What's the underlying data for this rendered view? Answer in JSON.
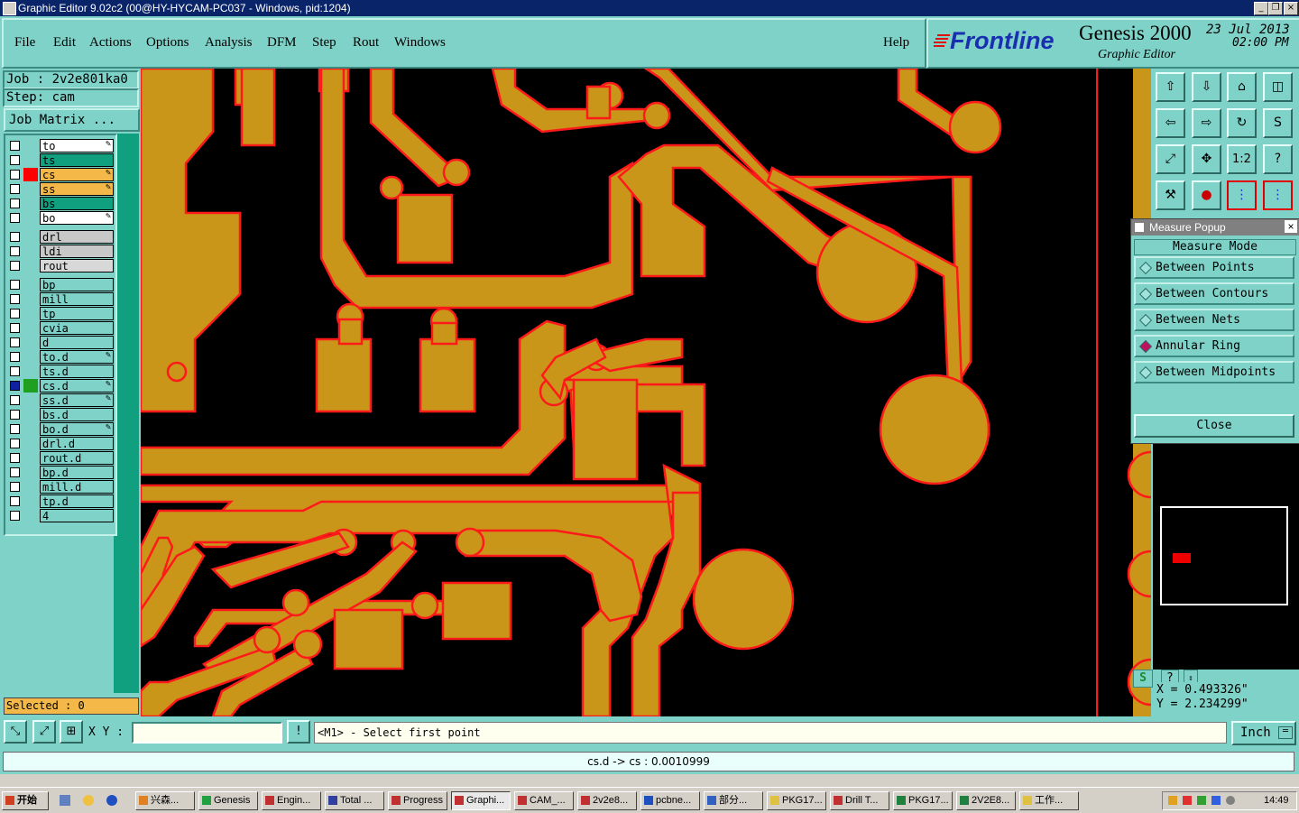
{
  "window": {
    "title": "Graphic Editor 9.02c2 (00@HY-HYCAM-PC037 - Windows, pid:1204)"
  },
  "menu": [
    "File",
    "Edit",
    "Actions",
    "Options",
    "Analysis",
    "DFM",
    "Step",
    "Rout",
    "Windows"
  ],
  "help_label": "Help",
  "brand": {
    "logo": "Frontline",
    "product": "Genesis 2000",
    "subtitle": "Graphic Editor",
    "date": "23 Jul 2013",
    "time": "02:00 PM"
  },
  "job": {
    "job": "Job : 2v2e801ka0",
    "step": "Step: cam",
    "matrix_button": "Job Matrix ..."
  },
  "layers": [
    {
      "name": "to",
      "bg": "#ffffff",
      "swatch": "",
      "edit": true
    },
    {
      "name": "ts",
      "bg": "#10a080",
      "swatch": "",
      "edit": false
    },
    {
      "name": "cs",
      "bg": "#f4b848",
      "swatch": "#ff0000",
      "edit": true
    },
    {
      "name": "ss",
      "bg": "#f4b848",
      "swatch": "",
      "edit": true
    },
    {
      "name": "bs",
      "bg": "#10a080",
      "swatch": "",
      "edit": false
    },
    {
      "name": "bo",
      "bg": "#ffffff",
      "swatch": "",
      "edit": true
    },
    {
      "name": "drl",
      "bg": "#c8c8c8",
      "swatch": "",
      "edit": false
    },
    {
      "name": "ldi",
      "bg": "#c8c8c8",
      "swatch": "",
      "edit": false
    },
    {
      "name": "rout",
      "bg": "#d8d8d8",
      "swatch": "",
      "edit": false
    },
    {
      "name": "bp",
      "bg": "#7fd2c8",
      "swatch": "",
      "edit": false
    },
    {
      "name": "mill",
      "bg": "#7fd2c8",
      "swatch": "",
      "edit": false
    },
    {
      "name": "tp",
      "bg": "#7fd2c8",
      "swatch": "",
      "edit": false
    },
    {
      "name": "cvia",
      "bg": "#7fd2c8",
      "swatch": "",
      "edit": false
    },
    {
      "name": "d",
      "bg": "#7fd2c8",
      "swatch": "",
      "edit": false
    },
    {
      "name": "to.d",
      "bg": "#7fd2c8",
      "swatch": "",
      "edit": true
    },
    {
      "name": "ts.d",
      "bg": "#7fd2c8",
      "swatch": "",
      "edit": false
    },
    {
      "name": "cs.d",
      "bg": "#7fd2c8",
      "swatch": "#20a020",
      "edit": true
    },
    {
      "name": "ss.d",
      "bg": "#7fd2c8",
      "swatch": "",
      "edit": true
    },
    {
      "name": "bs.d",
      "bg": "#7fd2c8",
      "swatch": "",
      "edit": false
    },
    {
      "name": "bo.d",
      "bg": "#7fd2c8",
      "swatch": "",
      "edit": true
    },
    {
      "name": "drl.d",
      "bg": "#7fd2c8",
      "swatch": "",
      "edit": false
    },
    {
      "name": "rout.d",
      "bg": "#7fd2c8",
      "swatch": "",
      "edit": false
    },
    {
      "name": "bp.d",
      "bg": "#7fd2c8",
      "swatch": "",
      "edit": false
    },
    {
      "name": "mill.d",
      "bg": "#7fd2c8",
      "swatch": "",
      "edit": false
    },
    {
      "name": "tp.d",
      "bg": "#7fd2c8",
      "swatch": "",
      "edit": false
    },
    {
      "name": "4",
      "bg": "#7fd2c8",
      "swatch": "",
      "edit": false
    }
  ],
  "selected": "Selected : 0",
  "measure": {
    "title": "Measure Popup",
    "mode_label": "Measure Mode",
    "options": [
      "Between Points",
      "Between Contours",
      "Between Nets",
      "Annular Ring",
      "Between Midpoints"
    ],
    "active_option": "Annular Ring",
    "close_label": "Close"
  },
  "tools": [
    "1:2",
    "?"
  ],
  "coords": {
    "x": "X = 0.493326\"",
    "y": "Y = 2.234299\""
  },
  "cmd": {
    "xy_label": "X Y :",
    "xy_value": "",
    "prompt": "<M1> - Select first point",
    "units": "Inch"
  },
  "message": "cs.d -> cs : 0.0010999",
  "taskbar": {
    "start": "开始",
    "tasks": [
      "兴森...",
      "Genesis",
      "Engin...",
      "Total ...",
      "Progress",
      "Graphi...",
      "CAM_...",
      "2v2e8...",
      "pcbne...",
      "部分...",
      "PKG17...",
      "Drill T...",
      "PKG17...",
      "2V2E8...",
      "工作..."
    ],
    "active_task": "Graphi...",
    "clock": "14:49"
  },
  "colors": {
    "board": "#c9961a",
    "edge": "#ff1a1a",
    "panel": "#7fd2c8",
    "canvas": "#000000"
  }
}
